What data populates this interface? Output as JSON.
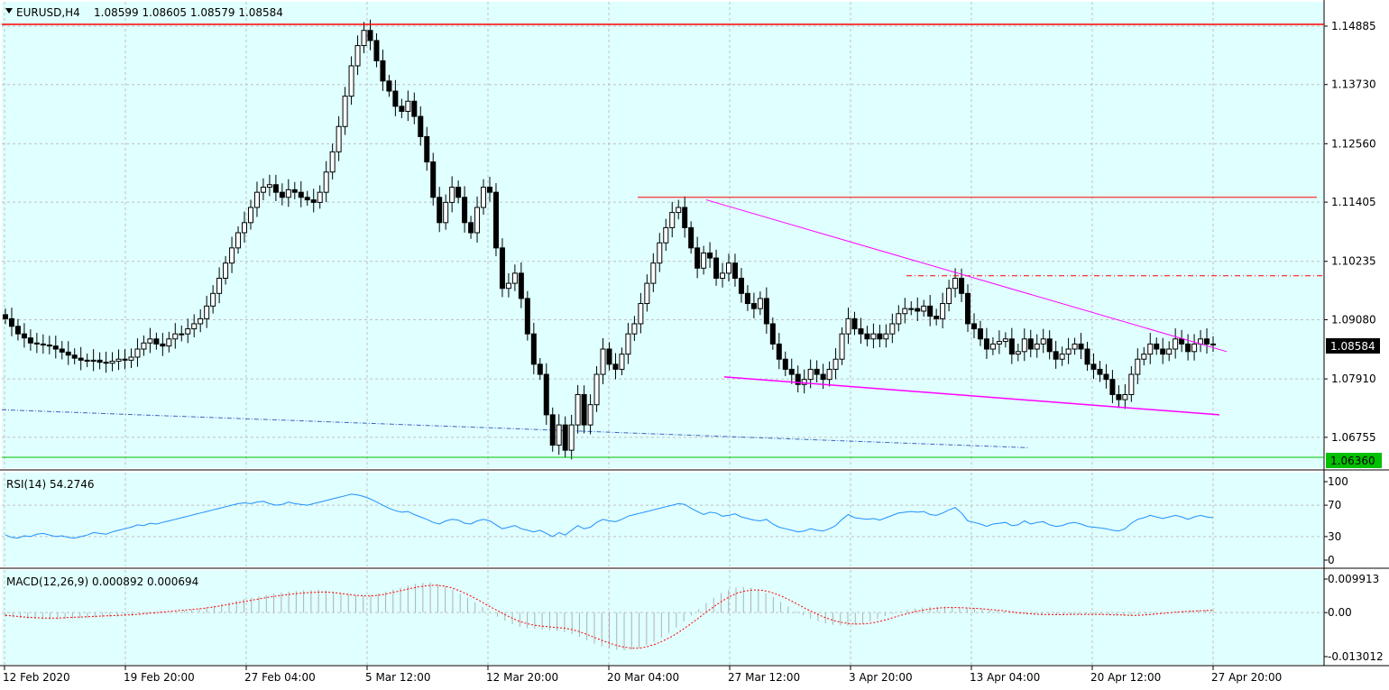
{
  "header": {
    "symbol": "EURUSD,H4",
    "ohlc": "1.08599 1.08605 1.08579 1.08584"
  },
  "colors": {
    "background": "#e0ffff",
    "candle": "#000000",
    "resistance": "#ff0000",
    "support": "#00c000",
    "trendline": "#ff00ff",
    "ma": "#4060c0",
    "rsi": "#1e90ff",
    "macd_signal": "#ff0000",
    "macd_hist": "#b0b0b0",
    "grid": "#c0c0c0"
  },
  "chart_data": [
    {
      "type": "candlestick",
      "title": "EURUSD,H4",
      "x_tick_labels": [
        "12 Feb 2020",
        "19 Feb 20:00",
        "27 Feb 04:00",
        "5 Mar 12:00",
        "12 Mar 20:00",
        "20 Mar 04:00",
        "27 Mar 12:00",
        "3 Apr 20:00",
        "13 Apr 04:00",
        "20 Apr 12:00",
        "27 Apr 20:00"
      ],
      "y_ticks": [
        "1.14885",
        "1.13730",
        "1.12560",
        "1.11405",
        "1.10235",
        "1.09080",
        "1.07910",
        "1.06755"
      ],
      "ylim": [
        1.0636,
        1.1492
      ],
      "current_price": "1.08584",
      "support_level": "1.06360",
      "resistance_level": 1.1492,
      "closes": [
        1.091,
        1.0895,
        1.088,
        1.0872,
        1.0862,
        1.086,
        1.0858,
        1.0856,
        1.085,
        1.0844,
        1.0838,
        1.0832,
        1.0828,
        1.0826,
        1.0828,
        1.0824,
        1.0822,
        1.0826,
        1.083,
        1.0828,
        1.0834,
        1.085,
        1.0862,
        1.087,
        1.086,
        1.0856,
        1.087,
        1.088,
        1.088,
        1.089,
        1.09,
        1.091,
        1.0935,
        1.096,
        1.099,
        1.102,
        1.105,
        1.108,
        1.11,
        1.113,
        1.116,
        1.117,
        1.1175,
        1.116,
        1.115,
        1.1165,
        1.116,
        1.115,
        1.1145,
        1.114,
        1.116,
        1.12,
        1.124,
        1.129,
        1.135,
        1.141,
        1.145,
        1.148,
        1.146,
        1.142,
        1.138,
        1.136,
        1.133,
        1.132,
        1.134,
        1.131,
        1.127,
        1.122,
        1.115,
        1.11,
        1.114,
        1.117,
        1.115,
        1.11,
        1.108,
        1.113,
        1.117,
        1.116,
        1.105,
        1.097,
        1.098,
        1.1,
        1.095,
        1.088,
        1.082,
        1.08,
        1.072,
        1.066,
        1.07,
        1.065,
        1.07,
        1.076,
        1.07,
        1.074,
        1.08,
        1.085,
        1.082,
        1.081,
        1.084,
        1.088,
        1.09,
        1.094,
        1.098,
        1.102,
        1.106,
        1.109,
        1.112,
        1.113,
        1.109,
        1.105,
        1.101,
        1.104,
        1.103,
        1.099,
        1.1,
        1.102,
        1.099,
        1.096,
        1.094,
        1.093,
        1.095,
        1.09,
        1.086,
        1.083,
        1.081,
        1.08,
        1.078,
        1.079,
        1.081,
        1.08,
        1.079,
        1.081,
        1.083,
        1.088,
        1.091,
        1.089,
        1.088,
        1.087,
        1.088,
        1.087,
        1.088,
        1.09,
        1.092,
        1.093,
        1.093,
        1.0925,
        1.0935,
        1.0915,
        1.091,
        1.094,
        1.097,
        1.099,
        1.096,
        1.09,
        1.089,
        1.087,
        1.085,
        1.086,
        1.0865,
        1.087,
        1.084,
        1.0845,
        1.087,
        1.085,
        1.086,
        1.087,
        1.0845,
        1.083,
        1.084,
        1.085,
        1.086,
        1.085,
        1.082,
        1.081,
        1.08,
        1.079,
        1.076,
        1.075,
        1.076,
        1.08,
        1.083,
        1.084,
        1.086,
        1.085,
        1.084,
        1.085,
        1.087,
        1.086,
        1.0845,
        1.086,
        1.087,
        1.086,
        1.0858
      ],
      "annotations": {
        "upper_resistance": 1.115,
        "dashdot_level": 1.0995,
        "upper_trend": [
          1.1145,
          1.0845
        ],
        "lower_trend": [
          1.0795,
          1.072
        ],
        "ma": [
          1.073,
          1.0655
        ]
      }
    },
    {
      "type": "line",
      "title": "RSI(14) 54.2746",
      "y_ticks": [
        "100",
        "70",
        "30",
        "0"
      ],
      "ylim": [
        0,
        100
      ],
      "values": [
        32,
        29,
        28,
        31,
        30,
        33,
        34,
        32,
        30,
        31,
        29,
        28,
        30,
        32,
        35,
        34,
        33,
        36,
        38,
        40,
        42,
        45,
        44,
        47,
        46,
        48,
        50,
        52,
        54,
        56,
        58,
        60,
        62,
        64,
        66,
        68,
        70,
        72,
        73,
        72,
        74,
        75,
        72,
        70,
        71,
        74,
        72,
        71,
        70,
        72,
        74,
        76,
        78,
        80,
        82,
        84,
        83,
        81,
        78,
        74,
        70,
        66,
        63,
        61,
        62,
        58,
        55,
        52,
        48,
        46,
        50,
        52,
        51,
        47,
        46,
        50,
        52,
        50,
        45,
        40,
        42,
        44,
        40,
        38,
        36,
        38,
        34,
        30,
        35,
        32,
        38,
        44,
        40,
        42,
        48,
        52,
        50,
        49,
        52,
        56,
        58,
        60,
        62,
        64,
        66,
        68,
        70,
        72,
        71,
        66,
        62,
        58,
        61,
        60,
        56,
        57,
        59,
        55,
        53,
        51,
        50,
        52,
        46,
        42,
        40,
        38,
        36,
        37,
        40,
        38,
        37,
        40,
        44,
        52,
        58,
        54,
        53,
        52,
        53,
        51,
        54,
        57,
        60,
        61,
        62,
        61,
        62,
        58,
        57,
        60,
        64,
        67,
        60,
        50,
        48,
        46,
        43,
        46,
        47,
        48,
        44,
        45,
        50,
        46,
        48,
        49,
        45,
        43,
        44,
        47,
        48,
        46,
        43,
        42,
        41,
        40,
        38,
        37,
        40,
        47,
        52,
        54,
        57,
        55,
        53,
        55,
        57,
        55,
        52,
        55,
        57,
        55,
        54
      ],
      "levels": [
        70,
        30
      ]
    },
    {
      "type": "bar+line",
      "title": "MACD(12,26,9) 0.000892 0.000694",
      "y_ticks": [
        "0.009913",
        "0.00",
        "-0.013012"
      ],
      "ylim": [
        -0.013012,
        0.009913
      ],
      "histogram": [
        -0.0012,
        -0.0014,
        -0.0016,
        -0.0018,
        -0.0019,
        -0.002,
        -0.002,
        -0.002,
        -0.0019,
        -0.0018,
        -0.0017,
        -0.0016,
        -0.0015,
        -0.0014,
        -0.0013,
        -0.0012,
        -0.0011,
        -0.001,
        -0.0008,
        -0.0006,
        -0.0004,
        -0.0002,
        0.0,
        0.0003,
        0.0006,
        0.0009,
        0.0012,
        0.0016,
        0.002,
        0.0025,
        0.003,
        0.0035,
        0.004,
        0.0044,
        0.0048,
        0.0052,
        0.0056,
        0.0059,
        0.0062,
        0.0064,
        0.0066,
        0.0067,
        0.0068,
        0.0066,
        0.0062,
        0.0058,
        0.0055,
        0.0052,
        0.005,
        0.0052,
        0.0056,
        0.0062,
        0.0068,
        0.0074,
        0.008,
        0.0085,
        0.0088,
        0.0089,
        0.0085,
        0.0078,
        0.0068,
        0.0056,
        0.0044,
        0.003,
        0.0016,
        0.0002,
        -0.0012,
        -0.0024,
        -0.0034,
        -0.0042,
        -0.0046,
        -0.0048,
        -0.005,
        -0.0052,
        -0.0054,
        -0.0058,
        -0.0064,
        -0.0072,
        -0.0082,
        -0.0092,
        -0.01,
        -0.0106,
        -0.011,
        -0.0112,
        -0.011,
        -0.0104,
        -0.0096,
        -0.0086,
        -0.0074,
        -0.006,
        -0.0044,
        -0.0026,
        -0.0008,
        0.001,
        0.0028,
        0.0044,
        0.0058,
        0.0068,
        0.0074,
        0.0076,
        0.0074,
        0.0068,
        0.0058,
        0.0046,
        0.0032,
        0.0018,
        0.0004,
        -0.0008,
        -0.0018,
        -0.0026,
        -0.0032,
        -0.0036,
        -0.0038,
        -0.0038,
        -0.0036,
        -0.0032,
        -0.0026,
        -0.0018,
        -0.001,
        -0.0004,
        0.0002,
        0.0008,
        0.0012,
        0.0015,
        0.0017,
        0.0018,
        0.0018,
        0.0017,
        0.0016,
        0.0015,
        0.0013,
        0.0011,
        0.0009,
        0.0006,
        0.0003,
        0.0,
        -0.0003,
        -0.0005,
        -0.0006,
        -0.0007,
        -0.0007,
        -0.0007,
        -0.0006,
        -0.0006,
        -0.0005,
        -0.0005,
        -0.0005,
        -0.0006,
        -0.0007,
        -0.0008,
        -0.0009,
        -0.0009,
        -0.0008,
        -0.0006,
        -0.0004,
        -0.0002,
        0.0,
        0.0002,
        0.0004,
        0.0006,
        0.0007,
        0.0008,
        0.0009
      ],
      "signal": [
        -0.0008,
        -0.001,
        -0.0012,
        -0.0014,
        -0.0015,
        -0.0016,
        -0.0016,
        -0.0016,
        -0.0015,
        -0.0014,
        -0.0013,
        -0.0012,
        -0.0011,
        -0.001,
        -0.0009,
        -0.0008,
        -0.0007,
        -0.0006,
        -0.0004,
        -0.0002,
        0.0,
        0.0002,
        0.0004,
        0.0006,
        0.0008,
        0.001,
        0.0012,
        0.0015,
        0.0018,
        0.0022,
        0.0026,
        0.003,
        0.0034,
        0.0038,
        0.0042,
        0.0046,
        0.0049,
        0.0052,
        0.0055,
        0.0057,
        0.0059,
        0.006,
        0.0061,
        0.006,
        0.0058,
        0.0055,
        0.0052,
        0.005,
        0.0049,
        0.005,
        0.0053,
        0.0058,
        0.0063,
        0.0068,
        0.0073,
        0.0077,
        0.008,
        0.0081,
        0.0079,
        0.0074,
        0.0066,
        0.0056,
        0.0045,
        0.0033,
        0.002,
        0.0008,
        -0.0004,
        -0.0015,
        -0.0025,
        -0.0032,
        -0.0037,
        -0.004,
        -0.0042,
        -0.0044,
        -0.0046,
        -0.005,
        -0.0056,
        -0.0064,
        -0.0073,
        -0.0082,
        -0.009,
        -0.0097,
        -0.0102,
        -0.0105,
        -0.0105,
        -0.0101,
        -0.0094,
        -0.0085,
        -0.0074,
        -0.0061,
        -0.0046,
        -0.003,
        -0.0013,
        0.0004,
        0.002,
        0.0035,
        0.0048,
        0.0058,
        0.0064,
        0.0067,
        0.0067,
        0.0063,
        0.0056,
        0.0047,
        0.0036,
        0.0024,
        0.0012,
        0.0001,
        -0.0009,
        -0.0018,
        -0.0025,
        -0.003,
        -0.0033,
        -0.0034,
        -0.0033,
        -0.003,
        -0.0025,
        -0.0019,
        -0.0012,
        -0.0006,
        0.0,
        0.0005,
        0.0009,
        0.0012,
        0.0014,
        0.0015,
        0.0015,
        0.0014,
        0.0013,
        0.0012,
        0.001,
        0.0008,
        0.0006,
        0.0003,
        0.0,
        -0.0002,
        -0.0004,
        -0.0005,
        -0.0006,
        -0.0006,
        -0.0006,
        -0.0005,
        -0.0005,
        -0.0005,
        -0.0005,
        -0.0005,
        -0.0006,
        -0.0007,
        -0.0007,
        -0.0008,
        -0.0008,
        -0.0007,
        -0.0005,
        -0.0003,
        -0.0001,
        0.0001,
        0.0003,
        0.0004,
        0.0005,
        0.0006,
        0.0007
      ]
    }
  ]
}
